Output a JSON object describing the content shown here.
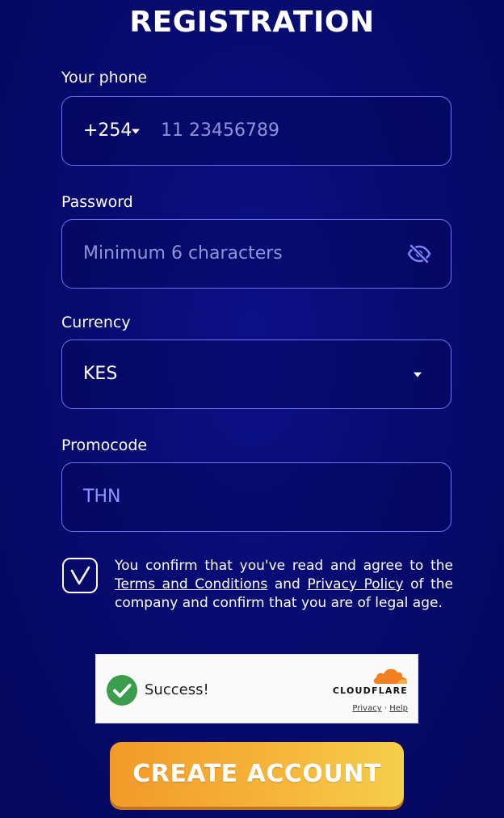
{
  "form": {
    "title": "REGISTRATION",
    "phone": {
      "label": "Your phone",
      "country_code": "+254",
      "placeholder": "11 23456789"
    },
    "password": {
      "label": "Password",
      "placeholder": "Minimum 6 characters",
      "visibility_icon": "eye-slash-icon"
    },
    "currency": {
      "label": "Currency",
      "selected": "KES"
    },
    "promocode": {
      "label": "Promocode",
      "value": "THN"
    },
    "agreement": {
      "checked": true,
      "text_before": "You confirm that you've read and agree to the ",
      "terms_link": "Terms and Conditions",
      "text_and": " and ",
      "privacy_link": "Privacy Policy",
      "text_after": " of the company and confirm that you are of legal age."
    },
    "submit_label": "CREATE ACCOUNT"
  },
  "captcha": {
    "status": "Success!",
    "brand": "CLOUDFLARE",
    "privacy_link": "Privacy",
    "separator": "·",
    "help_link": "Help"
  },
  "colors": {
    "background": "#080b70",
    "field_border": "#6c72f0",
    "promo_text": "#8f97ff",
    "button_gradient_start": "#f19a2a",
    "button_gradient_end": "#f5cf4a",
    "captcha_check": "#3b9c4b",
    "cloudflare_orange": "#f38020"
  }
}
